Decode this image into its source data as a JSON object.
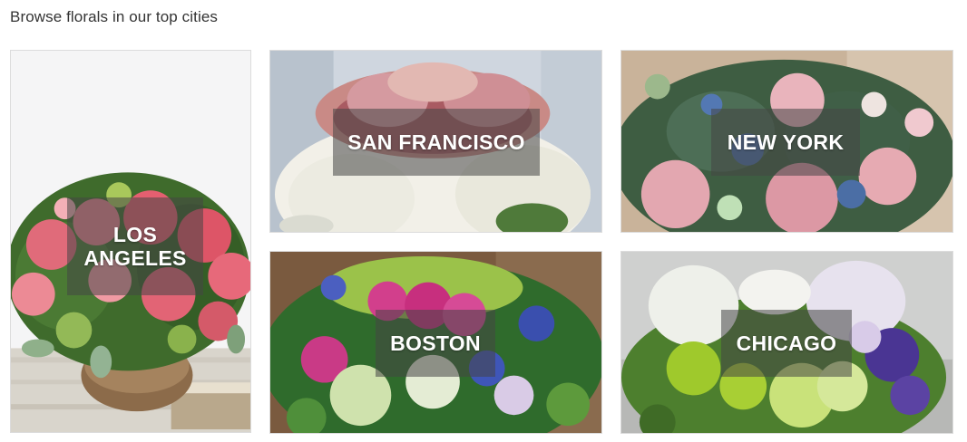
{
  "section": {
    "title": "Browse florals in our top cities"
  },
  "cities": [
    {
      "name": "LOS ANGELES",
      "line1": "LOS",
      "line2": "ANGELES"
    },
    {
      "name": "SAN FRANCISCO"
    },
    {
      "name": "NEW YORK"
    },
    {
      "name": "BOSTON"
    },
    {
      "name": "CHICAGO"
    }
  ]
}
